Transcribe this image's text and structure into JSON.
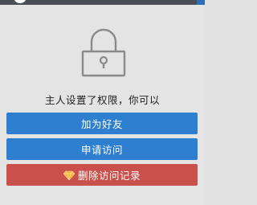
{
  "message": "主人设置了权限，你可以",
  "buttons": {
    "add_friend": "加为好友",
    "apply_visit": "申请访问",
    "delete_records": "删除访问记录"
  },
  "colors": {
    "primary": "#2e7fcf",
    "danger": "#c9504b",
    "background": "#e4e4e4"
  },
  "icons": {
    "lock": "lock-icon",
    "diamond": "diamond-icon"
  }
}
